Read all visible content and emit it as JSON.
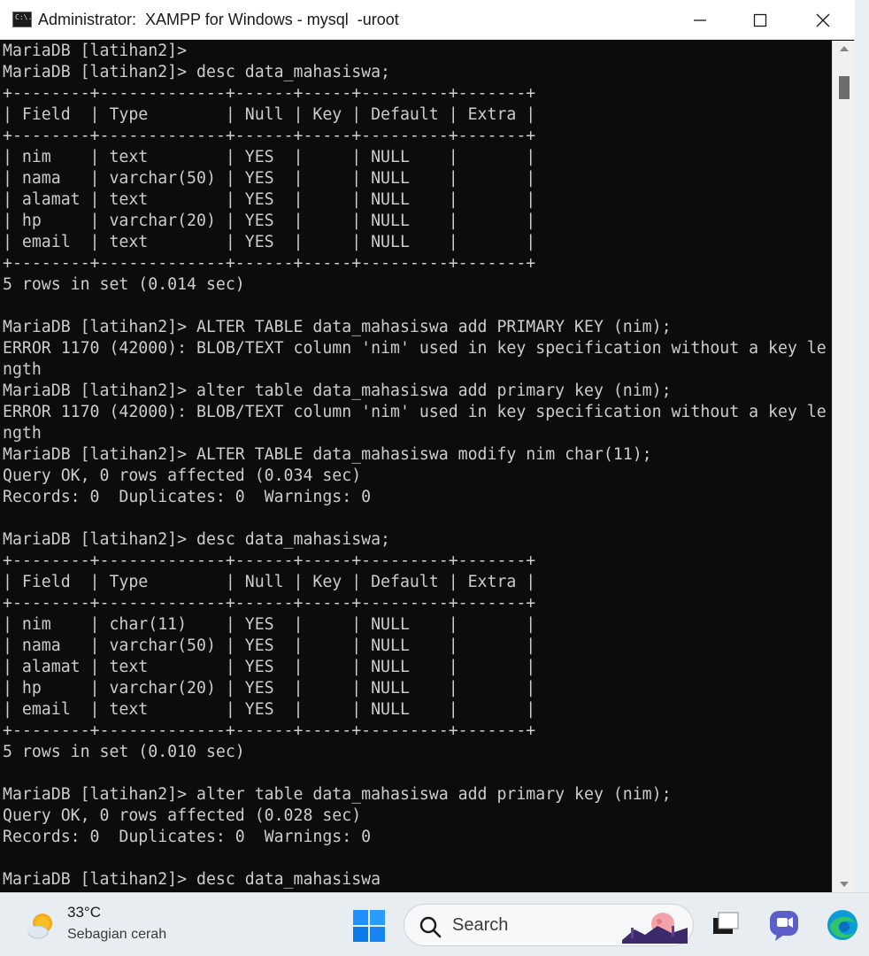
{
  "window": {
    "title": "Administrator:  XAMPP for Windows - mysql  -uroot",
    "icon_label": "C:\\."
  },
  "console": {
    "lines": [
      "MariaDB [latihan2]>",
      "MariaDB [latihan2]> desc data_mahasiswa;",
      "+--------+-------------+------+-----+---------+-------+",
      "| Field  | Type        | Null | Key | Default | Extra |",
      "+--------+-------------+------+-----+---------+-------+",
      "| nim    | text        | YES  |     | NULL    |       |",
      "| nama   | varchar(50) | YES  |     | NULL    |       |",
      "| alamat | text        | YES  |     | NULL    |       |",
      "| hp     | varchar(20) | YES  |     | NULL    |       |",
      "| email  | text        | YES  |     | NULL    |       |",
      "+--------+-------------+------+-----+---------+-------+",
      "5 rows in set (0.014 sec)",
      "",
      "MariaDB [latihan2]> ALTER TABLE data_mahasiswa add PRIMARY KEY (nim);",
      "ERROR 1170 (42000): BLOB/TEXT column 'nim' used in key specification without a key le",
      "ngth",
      "MariaDB [latihan2]> alter table data_mahasiswa add primary key (nim);",
      "ERROR 1170 (42000): BLOB/TEXT column 'nim' used in key specification without a key le",
      "ngth",
      "MariaDB [latihan2]> ALTER TABLE data_mahasiswa modify nim char(11);",
      "Query OK, 0 rows affected (0.034 sec)",
      "Records: 0  Duplicates: 0  Warnings: 0",
      "",
      "MariaDB [latihan2]> desc data_mahasiswa;",
      "+--------+-------------+------+-----+---------+-------+",
      "| Field  | Type        | Null | Key | Default | Extra |",
      "+--------+-------------+------+-----+---------+-------+",
      "| nim    | char(11)    | YES  |     | NULL    |       |",
      "| nama   | varchar(50) | YES  |     | NULL    |       |",
      "| alamat | text        | YES  |     | NULL    |       |",
      "| hp     | varchar(20) | YES  |     | NULL    |       |",
      "| email  | text        | YES  |     | NULL    |       |",
      "+--------+-------------+------+-----+---------+-------+",
      "5 rows in set (0.010 sec)",
      "",
      "MariaDB [latihan2]> alter table data_mahasiswa add primary key (nim);",
      "Query OK, 0 rows affected (0.028 sec)",
      "Records: 0  Duplicates: 0  Warnings: 0",
      "",
      "MariaDB [latihan2]> desc data_mahasiswa"
    ]
  },
  "taskbar": {
    "weather": {
      "temperature": "33°C",
      "condition": "Sebagian cerah"
    },
    "search_placeholder": "Search"
  },
  "colors": {
    "console_bg": "#0c0c0c",
    "console_text": "#cccccc",
    "titlebar_bg": "#ffffff",
    "taskbar_bg": "#e8edf1",
    "start_blue": "#0078d4"
  }
}
